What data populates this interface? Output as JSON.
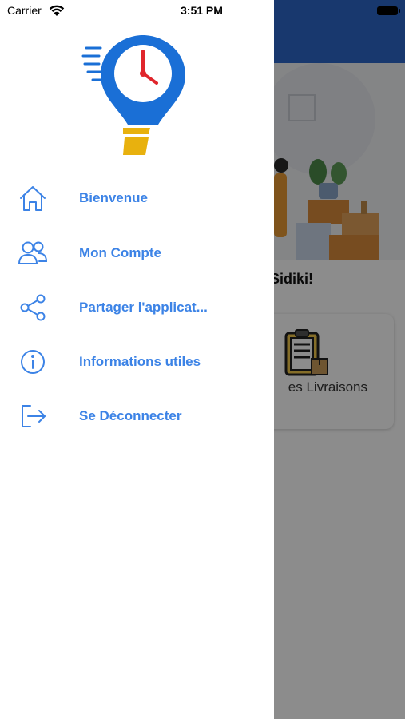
{
  "status_bar": {
    "carrier": "Carrier",
    "time": "3:51 PM"
  },
  "background_screen": {
    "greeting": "Sidiki!",
    "card_label": "es Livraisons"
  },
  "drawer": {
    "menu": [
      {
        "label": "Bienvenue",
        "icon": "home-icon"
      },
      {
        "label": "Mon Compte",
        "icon": "users-icon"
      },
      {
        "label": "Partager l'applicat...",
        "icon": "share-icon"
      },
      {
        "label": "Informations utiles",
        "icon": "info-icon"
      },
      {
        "label": "Se Déconnecter",
        "icon": "logout-icon"
      }
    ]
  },
  "colors": {
    "accent": "#3c83e6",
    "header_blue": "#2c67c9",
    "logo_blue": "#1a6fd6",
    "logo_yellow": "#e8b10e",
    "clock_hand": "#e0262c"
  }
}
